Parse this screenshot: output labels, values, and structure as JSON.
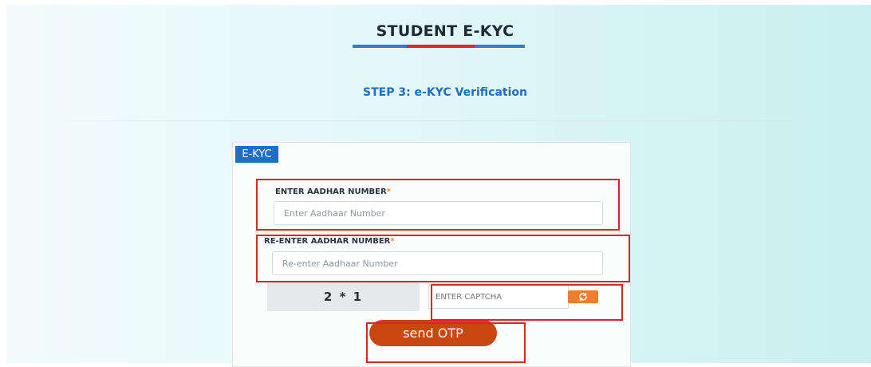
{
  "header": {
    "title": "STUDENT E-KYC",
    "underline_colors": [
      "#2f7fd0",
      "#e0262b",
      "#2f7fd0"
    ]
  },
  "step": {
    "label": "STEP 3: e-KYC Verification",
    "color": "#1e6fc0"
  },
  "form": {
    "tag_label": "E-KYC",
    "tag_color": "#1e6fc0",
    "aadhar": {
      "label": "ENTER AADHAR NUMBER",
      "required_mark": "*",
      "placeholder": "Enter Aadhaar Number",
      "value": ""
    },
    "reenter_aadhar": {
      "label": "RE-ENTER AADHAR NUMBER",
      "required_mark": "*",
      "placeholder": "Re-enter Aadhaar Number",
      "value": ""
    },
    "captcha": {
      "challenge": "2 * 1",
      "placeholder": "ENTER CAPTCHA",
      "refresh_icon": "refresh-icon"
    },
    "submit_label": "send OTP",
    "submit_color": "#c9460f",
    "refresh_color": "#f07c2e"
  },
  "highlight_color": "#e0222b"
}
